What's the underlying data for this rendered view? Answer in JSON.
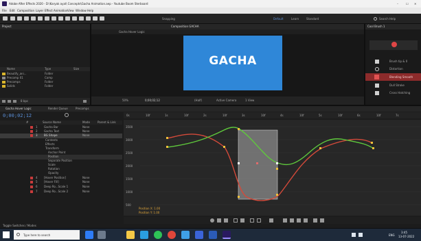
{
  "window": {
    "title": "Adobe After Effects 2020 - D:\\Karyak ayal\\ Concepts\\Gacha Animation.aep - Youtube Boom Sterboard",
    "menu": [
      "File",
      "Edit",
      "Composition",
      "Layer",
      "Effect",
      "Animation",
      "View",
      "Window",
      "Help"
    ],
    "controls": [
      "–",
      "☐",
      "✕"
    ]
  },
  "toolbar": {
    "snapping_label": "Snapping",
    "workspaces": [
      "Default",
      "Learn",
      "Standard"
    ],
    "search_label": "Search Help"
  },
  "project": {
    "tab": "Project",
    "columns": [
      "Name",
      "Type",
      "Size"
    ],
    "items": [
      {
        "name": "Beautify_ani...",
        "type": "Folder",
        "color": "#d9b52c"
      },
      {
        "name": "Precomp 01",
        "type": "Comp",
        "color": "#d9b52c"
      },
      {
        "name": "Precomps",
        "type": "Folder",
        "color": "#d9b52c"
      },
      {
        "name": "Solids",
        "type": "Folder",
        "color": "#d9b52c"
      }
    ],
    "bpc": "8 bpc"
  },
  "composition": {
    "tab": "Composition GACHA",
    "breadcrumb": "Gacha Hover Logic",
    "card_text": "GACHA",
    "card_color": "#2f87d8",
    "zoom": "50%",
    "resolution": "(Half)",
    "camera": "Active Camera",
    "views": "1 View",
    "timecode": "0;00;02;12"
  },
  "right_panel": {
    "tab": "Cool Brush 1",
    "items": [
      {
        "label": "Brush tip & 0",
        "icon": "feather-icon"
      },
      {
        "label": "Distortion",
        "icon": "spiral-icon"
      },
      {
        "label": "Blending Smooth",
        "icon": "blend-icon",
        "active": true
      },
      {
        "label": "Dull Stroke",
        "icon": "stroke-icon"
      },
      {
        "label": "Cross Hatching",
        "icon": "hatch-icon"
      }
    ]
  },
  "timeline": {
    "tabs": [
      "Gacha Hover Logic",
      "Render Queue",
      "Precomps"
    ],
    "timecode": "0;00;02;12",
    "columns": [
      "#",
      "Source Name",
      "Mode",
      "Parent & Link"
    ],
    "layers": [
      {
        "num": "1",
        "name": "Gacha Bar",
        "mode": "None",
        "color": "#c83b3b"
      },
      {
        "num": "2",
        "name": "Gacha Text",
        "mode": "None",
        "color": "#c83b3b"
      },
      {
        "num": "3",
        "name": "BG Shape",
        "mode": "None",
        "color": "#c83b3b",
        "selected": true
      },
      {
        "num": "",
        "name": "Contents",
        "mode": "",
        "color": ""
      },
      {
        "num": "",
        "name": "Effects",
        "mode": "",
        "color": ""
      },
      {
        "num": "",
        "name": "Transform",
        "mode": "",
        "color": ""
      },
      {
        "num": "",
        "name": "Anchor Point",
        "mode": "",
        "color": ""
      },
      {
        "num": "",
        "name": "Position",
        "mode": "",
        "color": ""
      },
      {
        "num": "",
        "name": "Separate Position",
        "mode": "",
        "color": ""
      },
      {
        "num": "",
        "name": "Scale",
        "mode": "",
        "color": ""
      },
      {
        "num": "",
        "name": "Rotation",
        "mode": "",
        "color": ""
      },
      {
        "num": "",
        "name": "Opacity",
        "mode": "",
        "color": ""
      },
      {
        "num": "4",
        "name": "[Hover Position]",
        "mode": "None",
        "color": "#c83b3b"
      },
      {
        "num": "5",
        "name": "[Hover Fill]",
        "mode": "None",
        "color": "#c83b3b"
      },
      {
        "num": "6",
        "name": "Deep Ro...Scale 1",
        "mode": "None",
        "color": "#c83b3b"
      },
      {
        "num": "7",
        "name": "Deep Ro...Scale 2",
        "mode": "None",
        "color": "#c83b3b"
      }
    ],
    "ruler": [
      "0s",
      "10f",
      "1s",
      "10f",
      "2s",
      "10f",
      "3s",
      "10f",
      "4s",
      "10f",
      "5s",
      "10f",
      "6s",
      "10f",
      "7s"
    ],
    "graph_values": [
      "3500",
      "3000",
      "2500",
      "2000",
      "1500",
      "1000",
      "500"
    ],
    "graph_info": [
      "Position X: 1.00",
      "Position Y: 1.00"
    ],
    "bottom_label": "Toggle Switches / Modes"
  },
  "graph": {
    "green_color": "#5fc93c",
    "red_color": "#d44a3a",
    "selection_fill": "#d9d9d9"
  },
  "taskbar": {
    "search_placeholder": "Type here to search",
    "language": "ENG",
    "time": "3:45",
    "date": "13-07-2022"
  }
}
